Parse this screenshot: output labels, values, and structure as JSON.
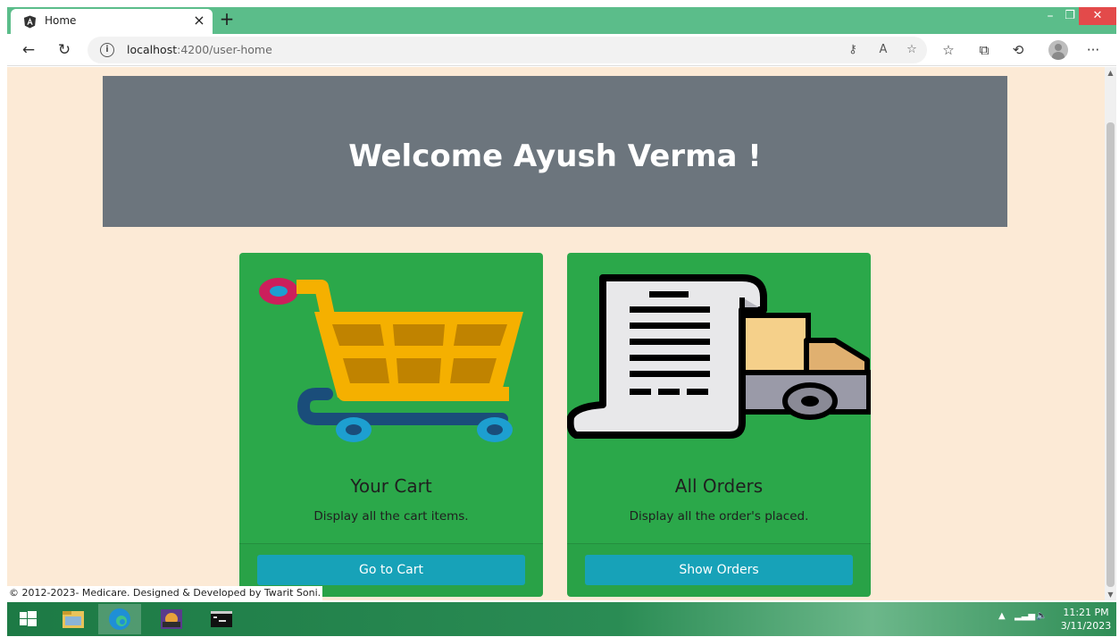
{
  "browser": {
    "tab_title": "Home",
    "tab_close": "×",
    "new_tab": "+",
    "window_min": "–",
    "window_restore": "❐",
    "window_close": "✕",
    "url_host": "localhost",
    "url_path": ":4200/user-home",
    "more": "···"
  },
  "page": {
    "welcome": "Welcome Ayush Verma !",
    "cards": [
      {
        "title": "Your Cart",
        "text": "Display all the cart items.",
        "button": "Go to Cart"
      },
      {
        "title": "All Orders",
        "text": "Display all the order's placed.",
        "button": "Show Orders"
      }
    ],
    "footer": "© 2012-2023- Medicare. Designed & Developed by Twarit Soni."
  },
  "taskbar": {
    "time": "11:21 PM",
    "date": "3/11/2023"
  },
  "colors": {
    "page_bg": "#fcead6",
    "jumbotron": "#6c757d",
    "card": "#2ba84a",
    "button": "#17a2b8",
    "tab_strip": "#5bbd8a"
  }
}
